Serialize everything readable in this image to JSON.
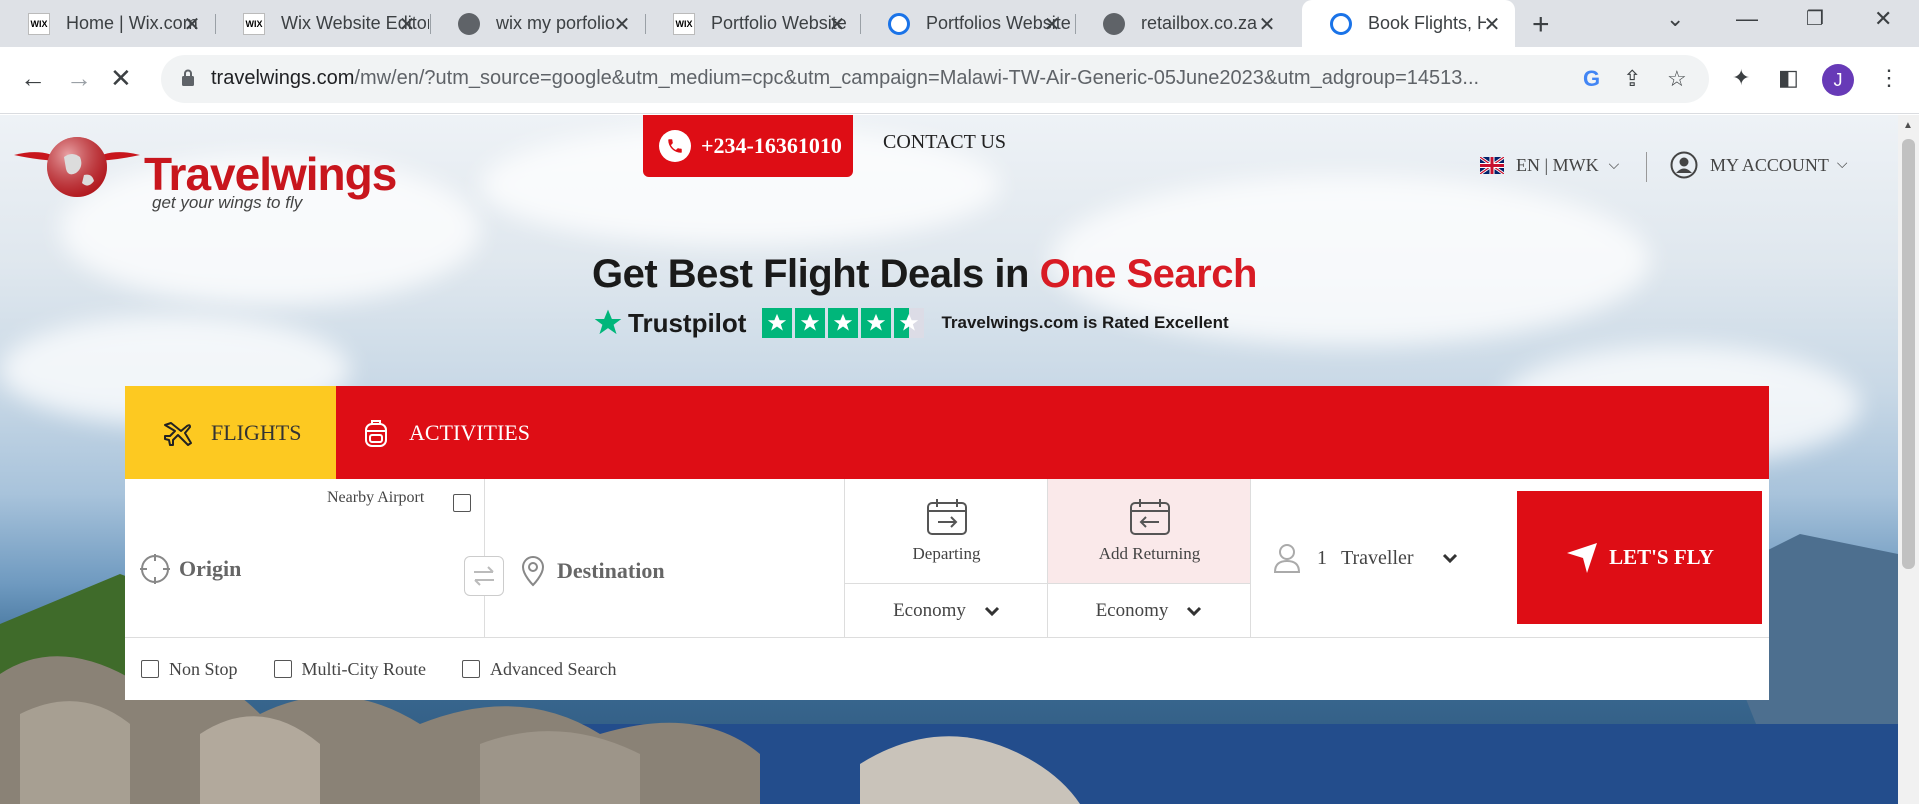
{
  "browser": {
    "tabs": [
      {
        "title": "Home | Wix.com",
        "favicon": "wix-icon"
      },
      {
        "title": "Wix Website Editor",
        "favicon": "wix-icon"
      },
      {
        "title": "wix my porfolio",
        "favicon": "globe-icon"
      },
      {
        "title": "Portfolio Website",
        "favicon": "wix-icon"
      },
      {
        "title": "Portfolios Website",
        "favicon": "loading-icon"
      },
      {
        "title": "retailbox.co.za",
        "favicon": "globe-icon"
      },
      {
        "title": "Book Flights, H",
        "favicon": "loading-icon",
        "active": true
      }
    ],
    "url_host": "travelwings.com",
    "url_path": "/mw/en/?utm_source=google&utm_medium=cpc&utm_campaign=Malawi-TW-Air-Generic-05June2023&utm_adgroup=14513...",
    "profile_initial": "J"
  },
  "header": {
    "logo_text": "Travelwings",
    "logo_tagline": "get your wings to fly",
    "phone": "+234-16361010",
    "contact_label": "CONTACT US",
    "language_currency": "EN | MWK",
    "account_label": "MY ACCOUNT"
  },
  "hero": {
    "title_main": "Get Best Flight Deals in ",
    "title_accent": "One Search",
    "trustpilot_label": "Trustpilot",
    "rating_text": "Travelwings.com is Rated Excellent",
    "stars": 4.5
  },
  "search": {
    "tabs": {
      "flights": "FLIGHTS",
      "activities": "ACTIVITIES"
    },
    "nearby_airport": "Nearby Airport",
    "origin_placeholder": "Origin",
    "destination_placeholder": "Destination",
    "departing_label": "Departing",
    "returning_label": "Add Returning",
    "depart_cabin": "Economy",
    "return_cabin": "Economy",
    "traveller_count": "1",
    "traveller_label": "Traveller",
    "submit_label": "LET'S FLY",
    "options": {
      "non_stop": "Non Stop",
      "multi_city": "Multi-City Route",
      "advanced": "Advanced Search"
    }
  },
  "colors": {
    "brand_red": "#de0d15",
    "flights_yellow": "#fdc921",
    "trustpilot_green": "#00b67a"
  }
}
